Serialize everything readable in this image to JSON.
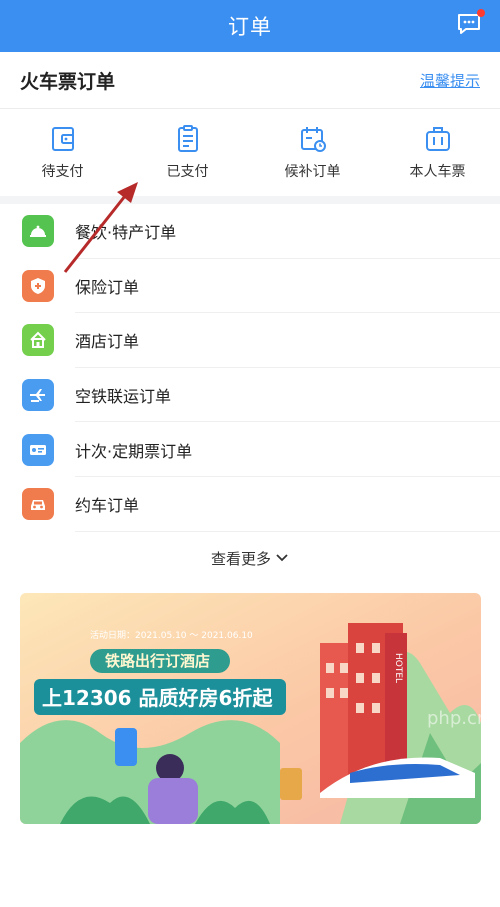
{
  "header": {
    "title": "订单"
  },
  "section": {
    "title": "火车票订单",
    "tip": "温馨提示"
  },
  "quick_actions": [
    {
      "label": "待支付",
      "icon": "wallet-icon"
    },
    {
      "label": "已支付",
      "icon": "receipt-icon"
    },
    {
      "label": "候补订单",
      "icon": "calendar-icon"
    },
    {
      "label": "本人车票",
      "icon": "luggage-icon"
    }
  ],
  "orders": [
    {
      "label": "餐饮·特产订单",
      "icon": "food-cloche-icon",
      "color": "#55c34f"
    },
    {
      "label": "保险订单",
      "icon": "shield-icon",
      "color": "#f07b4c"
    },
    {
      "label": "酒店订单",
      "icon": "hotel-icon",
      "color": "#74cf4d"
    },
    {
      "label": "空铁联运订单",
      "icon": "plane-train-icon",
      "color": "#4a9cf1"
    },
    {
      "label": "计次·定期票订单",
      "icon": "ticket-icon",
      "color": "#4a9cf1"
    },
    {
      "label": "约车订单",
      "icon": "car-icon",
      "color": "#f07b4c"
    }
  ],
  "more": {
    "label": "查看更多"
  },
  "banner": {
    "date": "活动日期：2021.05.10 ～ 2021.06.10",
    "headline": "铁路出行订酒店",
    "slogan": "上12306  品质好房6折起",
    "hotel_sign": "HOTEL"
  },
  "watermark": "php.cn",
  "colors": {
    "brand": "#3b8ff0",
    "arrow": "#b72a2a"
  }
}
